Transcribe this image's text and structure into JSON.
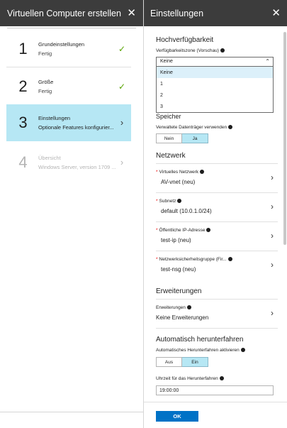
{
  "left_blade": {
    "title": "Virtuellen Computer erstellen",
    "close_glyph": "✕",
    "steps": [
      {
        "number": "1",
        "title": "Grundeinstellungen",
        "subtitle": "Fertig",
        "status": "done"
      },
      {
        "number": "2",
        "title": "Größe",
        "subtitle": "Fertig",
        "status": "done"
      },
      {
        "number": "3",
        "title": "Einstellungen",
        "subtitle": "Optionale Features konfigurier...",
        "status": "active"
      },
      {
        "number": "4",
        "title": "Übersicht",
        "subtitle": "Windows Server, version 1709 ...",
        "status": "disabled"
      }
    ],
    "check_glyph": "✓",
    "chevron_glyph": "›"
  },
  "right_blade": {
    "title": "Einstellungen",
    "close_glyph": "✕",
    "availability": {
      "heading": "Hochverfügbarkeit",
      "zone_label": "Verfügbarkeitszone (Vorschau)",
      "zone_value": "Keine",
      "zone_options": [
        "Keine",
        "1",
        "2",
        "3"
      ],
      "caret_glyph": "⌃"
    },
    "storage": {
      "heading": "Speicher",
      "managed_disks_label": "Verwaltete Datenträger verwenden",
      "options": [
        "Nein",
        "Ja"
      ],
      "selected": "Ja"
    },
    "network": {
      "heading": "Netzwerk",
      "rows": [
        {
          "label": "Virtuelles Netzwerk",
          "value": "AV-vnet (neu)",
          "required": true
        },
        {
          "label": "Subnetz",
          "value": "default (10.0.1.0/24)",
          "required": true
        },
        {
          "label": "Öffentliche IP-Adresse",
          "value": "test-ip (neu)",
          "required": true
        },
        {
          "label": "Netzwerksicherheitsgruppe (Fir...",
          "value": "test-nsg (neu)",
          "required": true
        }
      ]
    },
    "extensions": {
      "heading": "Erweiterungen",
      "row": {
        "label": "Erweiterungen",
        "value": "Keine Erweiterungen"
      }
    },
    "auto_shutdown": {
      "heading": "Automatisch herunterfahren",
      "enable_label": "Automatisches Herunterfahren aktivieren",
      "options": [
        "Aus",
        "Ein"
      ],
      "selected": "Ein",
      "time_label": "Uhrzeit für das Herunterfahren",
      "time_value": "19:00:00"
    },
    "ok_label": "OK"
  },
  "colors": {
    "header_bg": "#3c3c3c",
    "active_step_bg": "#b6e7f4",
    "check_green": "#57a300",
    "ok_button": "#0072c6",
    "required_red": "#e00000"
  }
}
